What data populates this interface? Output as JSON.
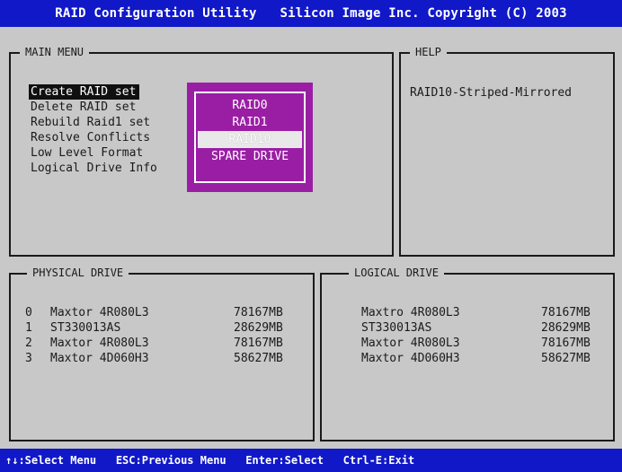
{
  "title": "RAID Configuration Utility   Silicon Image Inc. Copyright (C) 2003",
  "main_menu": {
    "title": "MAIN MENU",
    "items": [
      {
        "label": "Create RAID set",
        "selected": true
      },
      {
        "label": "Delete RAID set",
        "selected": false
      },
      {
        "label": "Rebuild Raid1 set",
        "selected": false
      },
      {
        "label": "Resolve Conflicts",
        "selected": false
      },
      {
        "label": "Low Level Format",
        "selected": false
      },
      {
        "label": "Logical Drive Info",
        "selected": false
      }
    ]
  },
  "popup": {
    "items": [
      "RAID0",
      "RAID1",
      "RAID10",
      "SPARE DRIVE"
    ],
    "highlighted": "RAID10"
  },
  "help": {
    "title": "HELP",
    "text": "RAID10-Striped-Mirrored"
  },
  "physical_drive": {
    "title": "PHYSICAL DRIVE",
    "rows": [
      {
        "index": "0",
        "model": "Maxtor 4R080L3",
        "size": "78167MB"
      },
      {
        "index": "1",
        "model": "ST330013AS",
        "size": "28629MB"
      },
      {
        "index": "2",
        "model": "Maxtor 4R080L3",
        "size": "78167MB"
      },
      {
        "index": "3",
        "model": "Maxtor 4D060H3",
        "size": "58627MB"
      }
    ]
  },
  "logical_drive": {
    "title": "LOGICAL DRIVE",
    "rows": [
      {
        "model": "Maxtro 4R080L3",
        "size": "78167MB"
      },
      {
        "model": "ST330013AS",
        "size": "28629MB"
      },
      {
        "model": "Maxtor 4R080L3",
        "size": "78167MB"
      },
      {
        "model": "Maxtor 4D060H3",
        "size": "58627MB"
      }
    ]
  },
  "statusbar": "↑↓:Select Menu   ESC:Previous Menu   Enter:Select   Ctrl-E:Exit",
  "colors": {
    "bar_blue": "#1018c8",
    "popup_purple": "#9a1ea4",
    "background": "#c8c8c8"
  }
}
